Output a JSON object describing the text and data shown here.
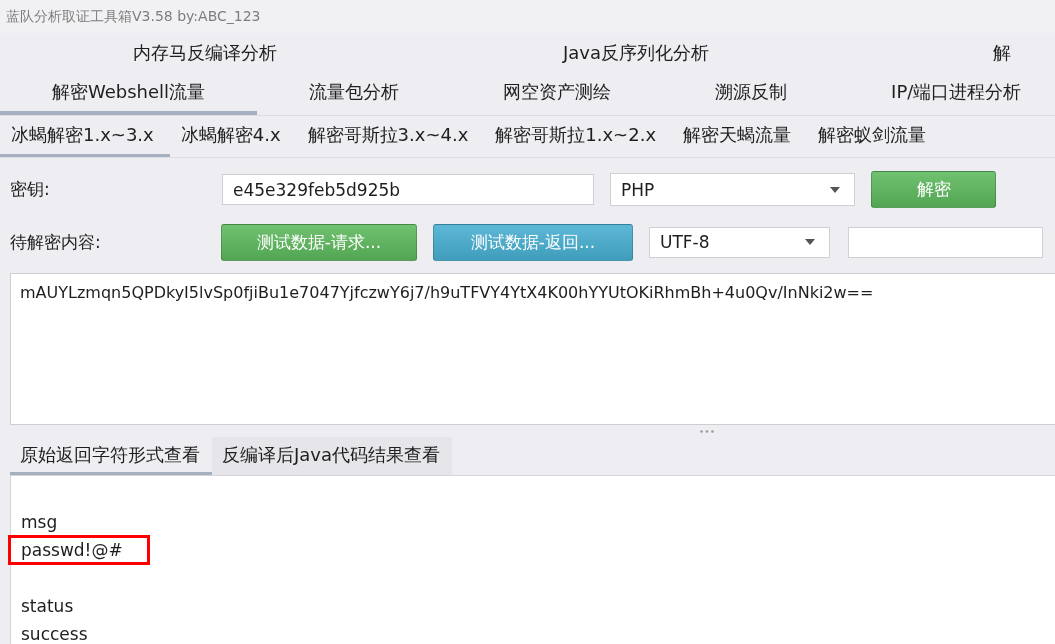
{
  "window": {
    "title": "蓝队分析取证工具箱V3.58 by:ABC_123"
  },
  "main_tabs": {
    "rows": [
      {
        "tabs": [
          {
            "label": "内存马反编译分析",
            "selected": false
          },
          {
            "label": "Java反序列化分析",
            "selected": false
          },
          {
            "label": "解",
            "selected": false
          }
        ]
      },
      {
        "tabs": [
          {
            "label": "解密Webshell流量",
            "selected": true
          },
          {
            "label": "流量包分析",
            "selected": false
          },
          {
            "label": "网空资产测绘",
            "selected": false
          },
          {
            "label": "溯源反制",
            "selected": false
          },
          {
            "label": "IP/端口进程分析",
            "selected": false
          }
        ]
      }
    ]
  },
  "sub_tabs": [
    {
      "label": "冰蝎解密1.x~3.x",
      "selected": true
    },
    {
      "label": "冰蝎解密4.x",
      "selected": false
    },
    {
      "label": "解密哥斯拉3.x~4.x",
      "selected": false
    },
    {
      "label": "解密哥斯拉1.x~2.x",
      "selected": false
    },
    {
      "label": "解密天蝎流量",
      "selected": false
    },
    {
      "label": "解密蚁剑流量",
      "selected": false
    }
  ],
  "key_row": {
    "label": "密钥:",
    "key_field": {
      "value": "e45e329feb5d925b"
    },
    "language_select": {
      "value": "PHP"
    },
    "decrypt_button": "解密"
  },
  "content_row": {
    "label": "待解密内容:",
    "sample_buttons": [
      {
        "label": "测试数据-请求...",
        "color": "#5cb85c"
      },
      {
        "label": "测试数据-返回...",
        "color": "#46aed0"
      }
    ],
    "encoding_select": {
      "value": "UTF-8"
    }
  },
  "ciphertext": "mAUYLzmqn5QPDkyI5lvSp0fjiBu1e7047YjfczwY6j7/h9uTFVY4YtX4K00hYYUtOKiRhmBh+4u0Qv/InNki2w==",
  "result_tabs": [
    {
      "label": "原始返回字符形式查看",
      "selected": true
    },
    {
      "label": "反编译后Java代码结果查看",
      "selected": false
    }
  ],
  "output": {
    "entries": [
      {
        "key": "msg",
        "value": "passwd!@#",
        "highlighted": true
      },
      {
        "key": "status",
        "value": "success",
        "highlighted": false
      }
    ]
  }
}
